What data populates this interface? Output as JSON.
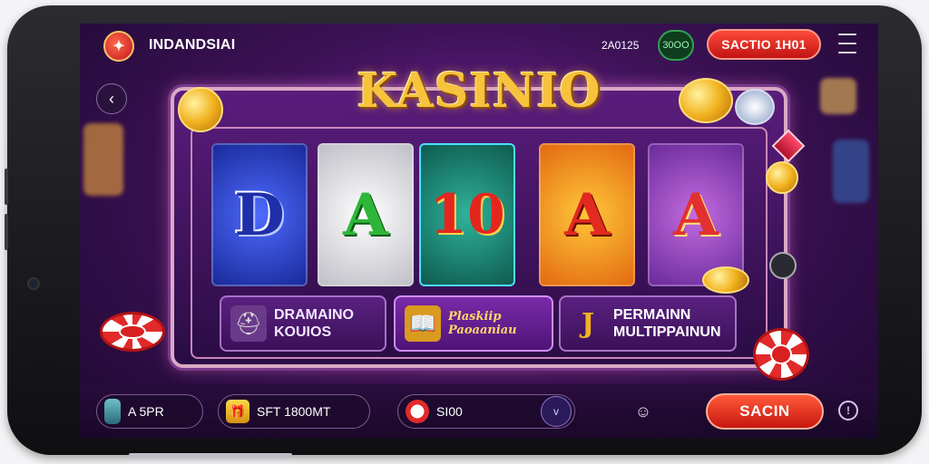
{
  "header": {
    "brand_name": "INDANDSIAI",
    "logo_icon": "eagle-logo-icon",
    "balance": "2A0125",
    "green_pill": "30OO",
    "action_button": "SACTIO  1H01",
    "menu_icon": "hamburger-menu-icon"
  },
  "navigation": {
    "back_icon": "chevron-left-icon",
    "back_glyph": "‹"
  },
  "game": {
    "title": "KASINIO",
    "reels": [
      {
        "symbol": "D",
        "color": "#3a5cff"
      },
      {
        "symbol": "A",
        "color": "#2fb63a"
      },
      {
        "symbol": "10",
        "color": "#e5261e"
      },
      {
        "symbol": "A",
        "color": "#e22a20"
      },
      {
        "symbol": "A",
        "color": "#e23030"
      }
    ],
    "features": [
      {
        "icon": "helmet-icon",
        "glyph": "⛑",
        "label": "DRAMAINO\nKOUIOS"
      },
      {
        "icon": "book-icon",
        "glyph": "📖",
        "label": "Plaskiip\nPaoaaniau"
      },
      {
        "icon": "hook-icon",
        "glyph": "J",
        "label": "PERMAINN\nMULTIPPAINUN"
      }
    ]
  },
  "footer": {
    "item_1": {
      "icon": "bottle-icon",
      "label": "A 5PR"
    },
    "item_2": {
      "icon": "treasure-icon",
      "glyph": "🎁",
      "label": "SFT 1800MT"
    },
    "item_3": {
      "icon": "poker-chip-icon",
      "glyph": "●",
      "label": "SI00"
    },
    "dropdown_glyph": "v",
    "chat_glyph": "☺",
    "spin_label": "SACIN",
    "info_glyph": "!"
  },
  "colors": {
    "accent_gold": "#f7c23c",
    "accent_red": "#e22a2a",
    "background_purple": "#3e1258"
  }
}
